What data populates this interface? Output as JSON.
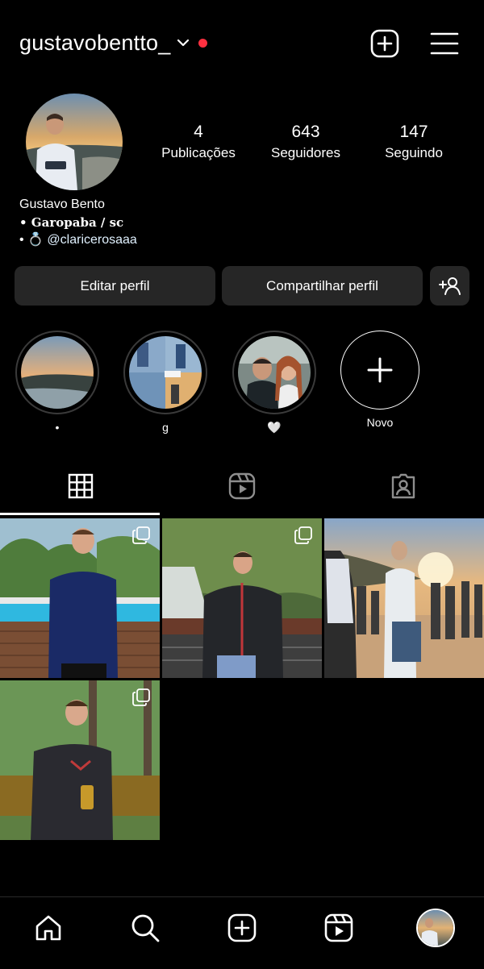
{
  "header": {
    "username": "gustavobentto_",
    "icons": {
      "dropdown": "chevron-down-icon",
      "notification_dot": "red-dot-icon",
      "create": "add-square-icon",
      "menu": "hamburger-menu-icon"
    },
    "accent_color": "#ff3040"
  },
  "profile": {
    "stats": [
      {
        "value": "4",
        "label": "Publicações"
      },
      {
        "value": "643",
        "label": "Seguidores"
      },
      {
        "value": "147",
        "label": "Seguindo"
      }
    ],
    "name": "Gustavo Bento",
    "bio_line1": "• Garopaba / sc",
    "bio_line2_prefix": "• 💍",
    "bio_mention": "@claricerosaaa"
  },
  "actions": {
    "edit": "Editar perfil",
    "share": "Compartilhar perfil",
    "add_user_icon": "add-person-icon"
  },
  "highlights": [
    {
      "label": "•"
    },
    {
      "label": "g"
    },
    {
      "label": "🤍"
    },
    {
      "label": "Novo"
    }
  ],
  "tabs": [
    "grid-icon",
    "reels-icon",
    "tagged-icon"
  ],
  "posts": [
    {
      "multiple": true
    },
    {
      "multiple": true
    },
    {
      "multiple": false
    },
    {
      "multiple": true
    }
  ],
  "bottom_nav": [
    "home-icon",
    "search-icon",
    "create-icon",
    "reels-icon",
    "profile-avatar"
  ],
  "colors": {
    "background": "#000000",
    "button_bg": "#262626",
    "text": "#ffffff"
  }
}
